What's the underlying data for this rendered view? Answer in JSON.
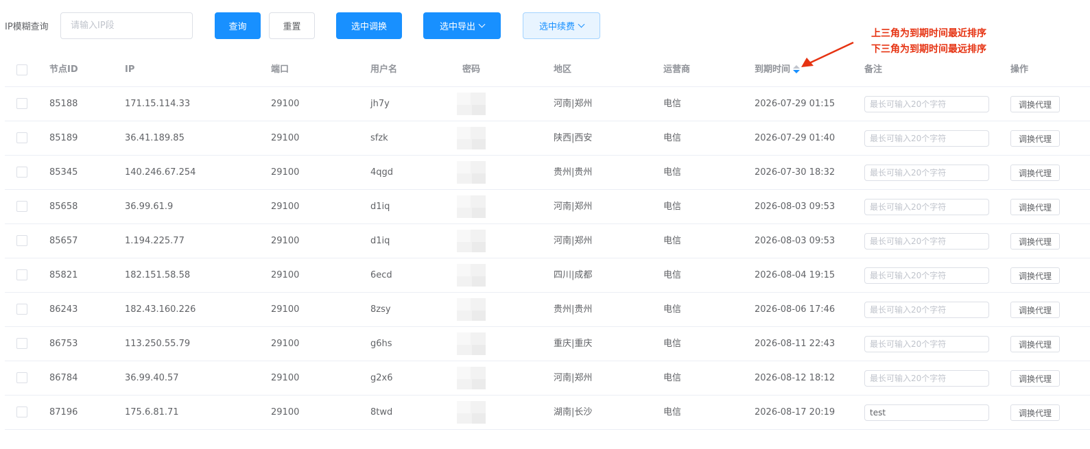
{
  "filters": {
    "ip_label": "IP模糊查询",
    "ip_placeholder": "请输入IP段",
    "ip_value": "",
    "query_label": "查询",
    "reset_label": "重置",
    "switch_selected_label": "选中调换",
    "export_selected_label": "选中导出",
    "renew_selected_label": "选中续费"
  },
  "annotation": {
    "line1": "上三角为到期时间最近排序",
    "line2": "下三角为到期时间最远排序",
    "color": "#e63312"
  },
  "colors": {
    "primary": "#1890ff",
    "plain_bg": "#e8f4ff",
    "border": "#dcdfe6",
    "header_text": "#909399"
  },
  "table": {
    "headers": {
      "node_id": "节点ID",
      "ip": "IP",
      "port": "端口",
      "username": "用户名",
      "password": "密码",
      "region": "地区",
      "operator": "运营商",
      "expire": "到期时间",
      "remark": "备注",
      "action": "操作"
    },
    "remark_placeholder": "最长可输入20个字符",
    "action_label": "调换代理",
    "rows": [
      {
        "node_id": "85188",
        "ip": "171.15.114.33",
        "port": "29100",
        "username": "jh7y",
        "region": "河南|郑州",
        "operator": "电信",
        "expire": "2026-07-29 01:15",
        "remark": ""
      },
      {
        "node_id": "85189",
        "ip": "36.41.189.85",
        "port": "29100",
        "username": "sfzk",
        "region": "陕西|西安",
        "operator": "电信",
        "expire": "2026-07-29 01:40",
        "remark": ""
      },
      {
        "node_id": "85345",
        "ip": "140.246.67.254",
        "port": "29100",
        "username": "4qgd",
        "region": "贵州|贵州",
        "operator": "电信",
        "expire": "2026-07-30 18:32",
        "remark": ""
      },
      {
        "node_id": "85658",
        "ip": "36.99.61.9",
        "port": "29100",
        "username": "d1iq",
        "region": "河南|郑州",
        "operator": "电信",
        "expire": "2026-08-03 09:53",
        "remark": ""
      },
      {
        "node_id": "85657",
        "ip": "1.194.225.77",
        "port": "29100",
        "username": "d1iq",
        "region": "河南|郑州",
        "operator": "电信",
        "expire": "2026-08-03 09:53",
        "remark": ""
      },
      {
        "node_id": "85821",
        "ip": "182.151.58.58",
        "port": "29100",
        "username": "6ecd",
        "region": "四川|成都",
        "operator": "电信",
        "expire": "2026-08-04 19:15",
        "remark": ""
      },
      {
        "node_id": "86243",
        "ip": "182.43.160.226",
        "port": "29100",
        "username": "8zsy",
        "region": "贵州|贵州",
        "operator": "电信",
        "expire": "2026-08-06 17:46",
        "remark": ""
      },
      {
        "node_id": "86753",
        "ip": "113.250.55.79",
        "port": "29100",
        "username": "g6hs",
        "region": "重庆|重庆",
        "operator": "电信",
        "expire": "2026-08-11 22:43",
        "remark": ""
      },
      {
        "node_id": "86784",
        "ip": "36.99.40.57",
        "port": "29100",
        "username": "g2x6",
        "region": "河南|郑州",
        "operator": "电信",
        "expire": "2026-08-12 18:12",
        "remark": ""
      },
      {
        "node_id": "87196",
        "ip": "175.6.81.71",
        "port": "29100",
        "username": "8twd",
        "region": "湖南|长沙",
        "operator": "电信",
        "expire": "2026-08-17 20:19",
        "remark": "test"
      }
    ]
  }
}
